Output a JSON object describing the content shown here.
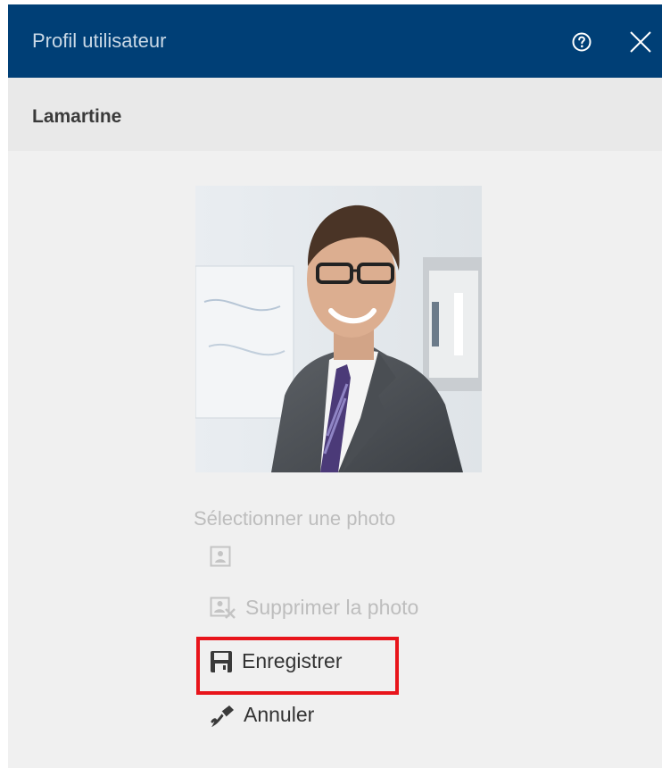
{
  "window": {
    "title": "Profil utilisateur",
    "help_icon": "help-circle-icon",
    "close_icon": "close-icon"
  },
  "user": {
    "name": "Lamartine"
  },
  "photo_section": {
    "select_label": "Sélectionner une photo",
    "upload_icon": "image-placeholder-icon",
    "delete_label": "Supprimer la photo",
    "delete_icon": "image-delete-icon"
  },
  "actions": {
    "save_label": "Enregistrer",
    "save_icon": "floppy-disk-icon",
    "cancel_label": "Annuler",
    "cancel_icon": "eraser-icon"
  },
  "colors": {
    "header_bg": "#003f76",
    "highlight": "#e8141b",
    "disabled_text": "#bdbdbd"
  }
}
